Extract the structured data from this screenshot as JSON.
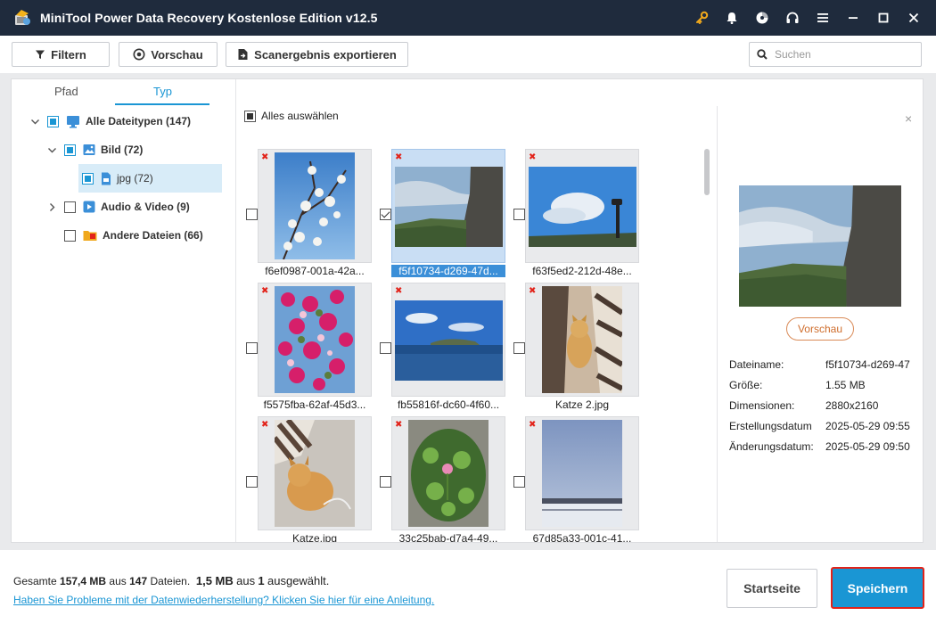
{
  "window": {
    "title": "MiniTool Power Data Recovery Kostenlose Edition v12.5",
    "title_icons": [
      "key-icon",
      "bell-icon",
      "disc-icon",
      "headset-icon",
      "menu-icon",
      "minimize-icon",
      "maximize-icon",
      "close-icon"
    ]
  },
  "toolbar": {
    "filter_label": "Filtern",
    "preview_label": "Vorschau",
    "export_label": "Scanergebnis exportieren",
    "search_placeholder": "Suchen"
  },
  "tabs": {
    "path": "Pfad",
    "type": "Typ",
    "active": "type"
  },
  "tree": {
    "all": "Alle Dateitypen (147)",
    "image": "Bild (72)",
    "jpg": "jpg (72)",
    "audio_video": "Audio & Video (9)",
    "other": "Andere Dateien (66)"
  },
  "grid": {
    "select_all": "Alles auswählen",
    "files": [
      {
        "name": "f6ef0987-001a-42a...",
        "selected": false,
        "checked": false
      },
      {
        "name": "f5f10734-d269-47d...",
        "selected": true,
        "checked": true
      },
      {
        "name": "f63f5ed2-212d-48e...",
        "selected": false,
        "checked": false
      },
      {
        "name": "f5575fba-62af-45d3...",
        "selected": false,
        "checked": false
      },
      {
        "name": "fb55816f-dc60-4f60...",
        "selected": false,
        "checked": false
      },
      {
        "name": "Katze 2.jpg",
        "selected": false,
        "checked": false
      },
      {
        "name": "Katze.jpg",
        "selected": false,
        "checked": false
      },
      {
        "name": "33c25bab-d7a4-49...",
        "selected": false,
        "checked": false
      },
      {
        "name": "67d85a33-001c-41...",
        "selected": false,
        "checked": false
      }
    ]
  },
  "preview": {
    "button_label": "Vorschau",
    "close_glyph": "×",
    "info": {
      "filename_label": "Dateiname:",
      "filename_value": "f5f10734-d269-47",
      "size_label": "Größe:",
      "size_value": "1.55 MB",
      "dimensions_label": "Dimensionen:",
      "dimensions_value": "2880x2160",
      "created_label": "Erstellungsdatum",
      "created_value": "2025-05-29 09:55",
      "modified_label": "Änderungsdatum:",
      "modified_value": "2025-05-29 09:50"
    }
  },
  "footer": {
    "summary_prefix": "Gesamte",
    "total_size": "157,4 MB",
    "summary_from": "aus",
    "total_files": "147",
    "summary_files": "Dateien.",
    "selected_size": "1,5 MB",
    "summary_from2": "aus",
    "selected_count": "1",
    "summary_selected": "ausgewählt.",
    "help_link": "Haben Sie Probleme mit der Datenwiederherstellung? Klicken Sie hier für eine Anleitung.",
    "home_label": "Startseite",
    "save_label": "Speichern"
  },
  "colors": {
    "titlebar": "#1f2b3d",
    "accent": "#1a96d4",
    "save_border": "#e2231a",
    "preview_button": "#cf6d2c"
  }
}
